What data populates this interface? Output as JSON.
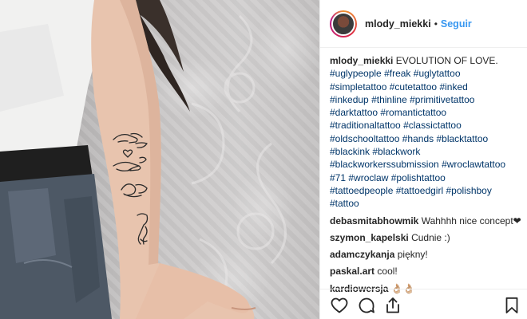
{
  "post": {
    "username": "mlody_miekki",
    "separator": "•",
    "follow_label": "Seguir"
  },
  "caption": {
    "username": "mlody_miekki",
    "text": "EVOLUTION OF LOVE.",
    "hashtags": [
      "#uglypeople",
      "#freak",
      "#uglytattoo",
      "#simpletattoo",
      "#cutetattoo",
      "#inked",
      "#inkedup",
      "#thinline",
      "#primitivetattoo",
      "#darktattoo",
      "#romantictattoo",
      "#traditionaltattoo",
      "#classictattoo",
      "#oldschooltattoo",
      "#hands",
      "#blacktattoo",
      "#blackink",
      "#blackwork",
      "#blackworkerssubmission",
      "#wroclawtattoo",
      "#71",
      "#wroclaw",
      "#polishtattoo",
      "#tattoedpeople",
      "#tattoedgirl",
      "#polishboy",
      "#tattoo"
    ]
  },
  "comments": [
    {
      "username": "debasmitabhowmik",
      "text": "Wahhhh nice concept❤"
    },
    {
      "username": "szymon_kapelski",
      "text": "Cudnie :)"
    },
    {
      "username": "adamczykanja",
      "text": "piękny!"
    },
    {
      "username": "paskal.art",
      "text": "cool!"
    },
    {
      "username": "kardiowersja",
      "text": "👌🏼👌🏼"
    }
  ],
  "actions": {
    "icons": [
      "heart-icon",
      "comment-icon",
      "share-icon",
      "bookmark-icon"
    ]
  },
  "colors": {
    "link_blue": "#3897f0",
    "hashtag_blue": "#003569",
    "text": "#262626",
    "divider": "#efefef"
  }
}
